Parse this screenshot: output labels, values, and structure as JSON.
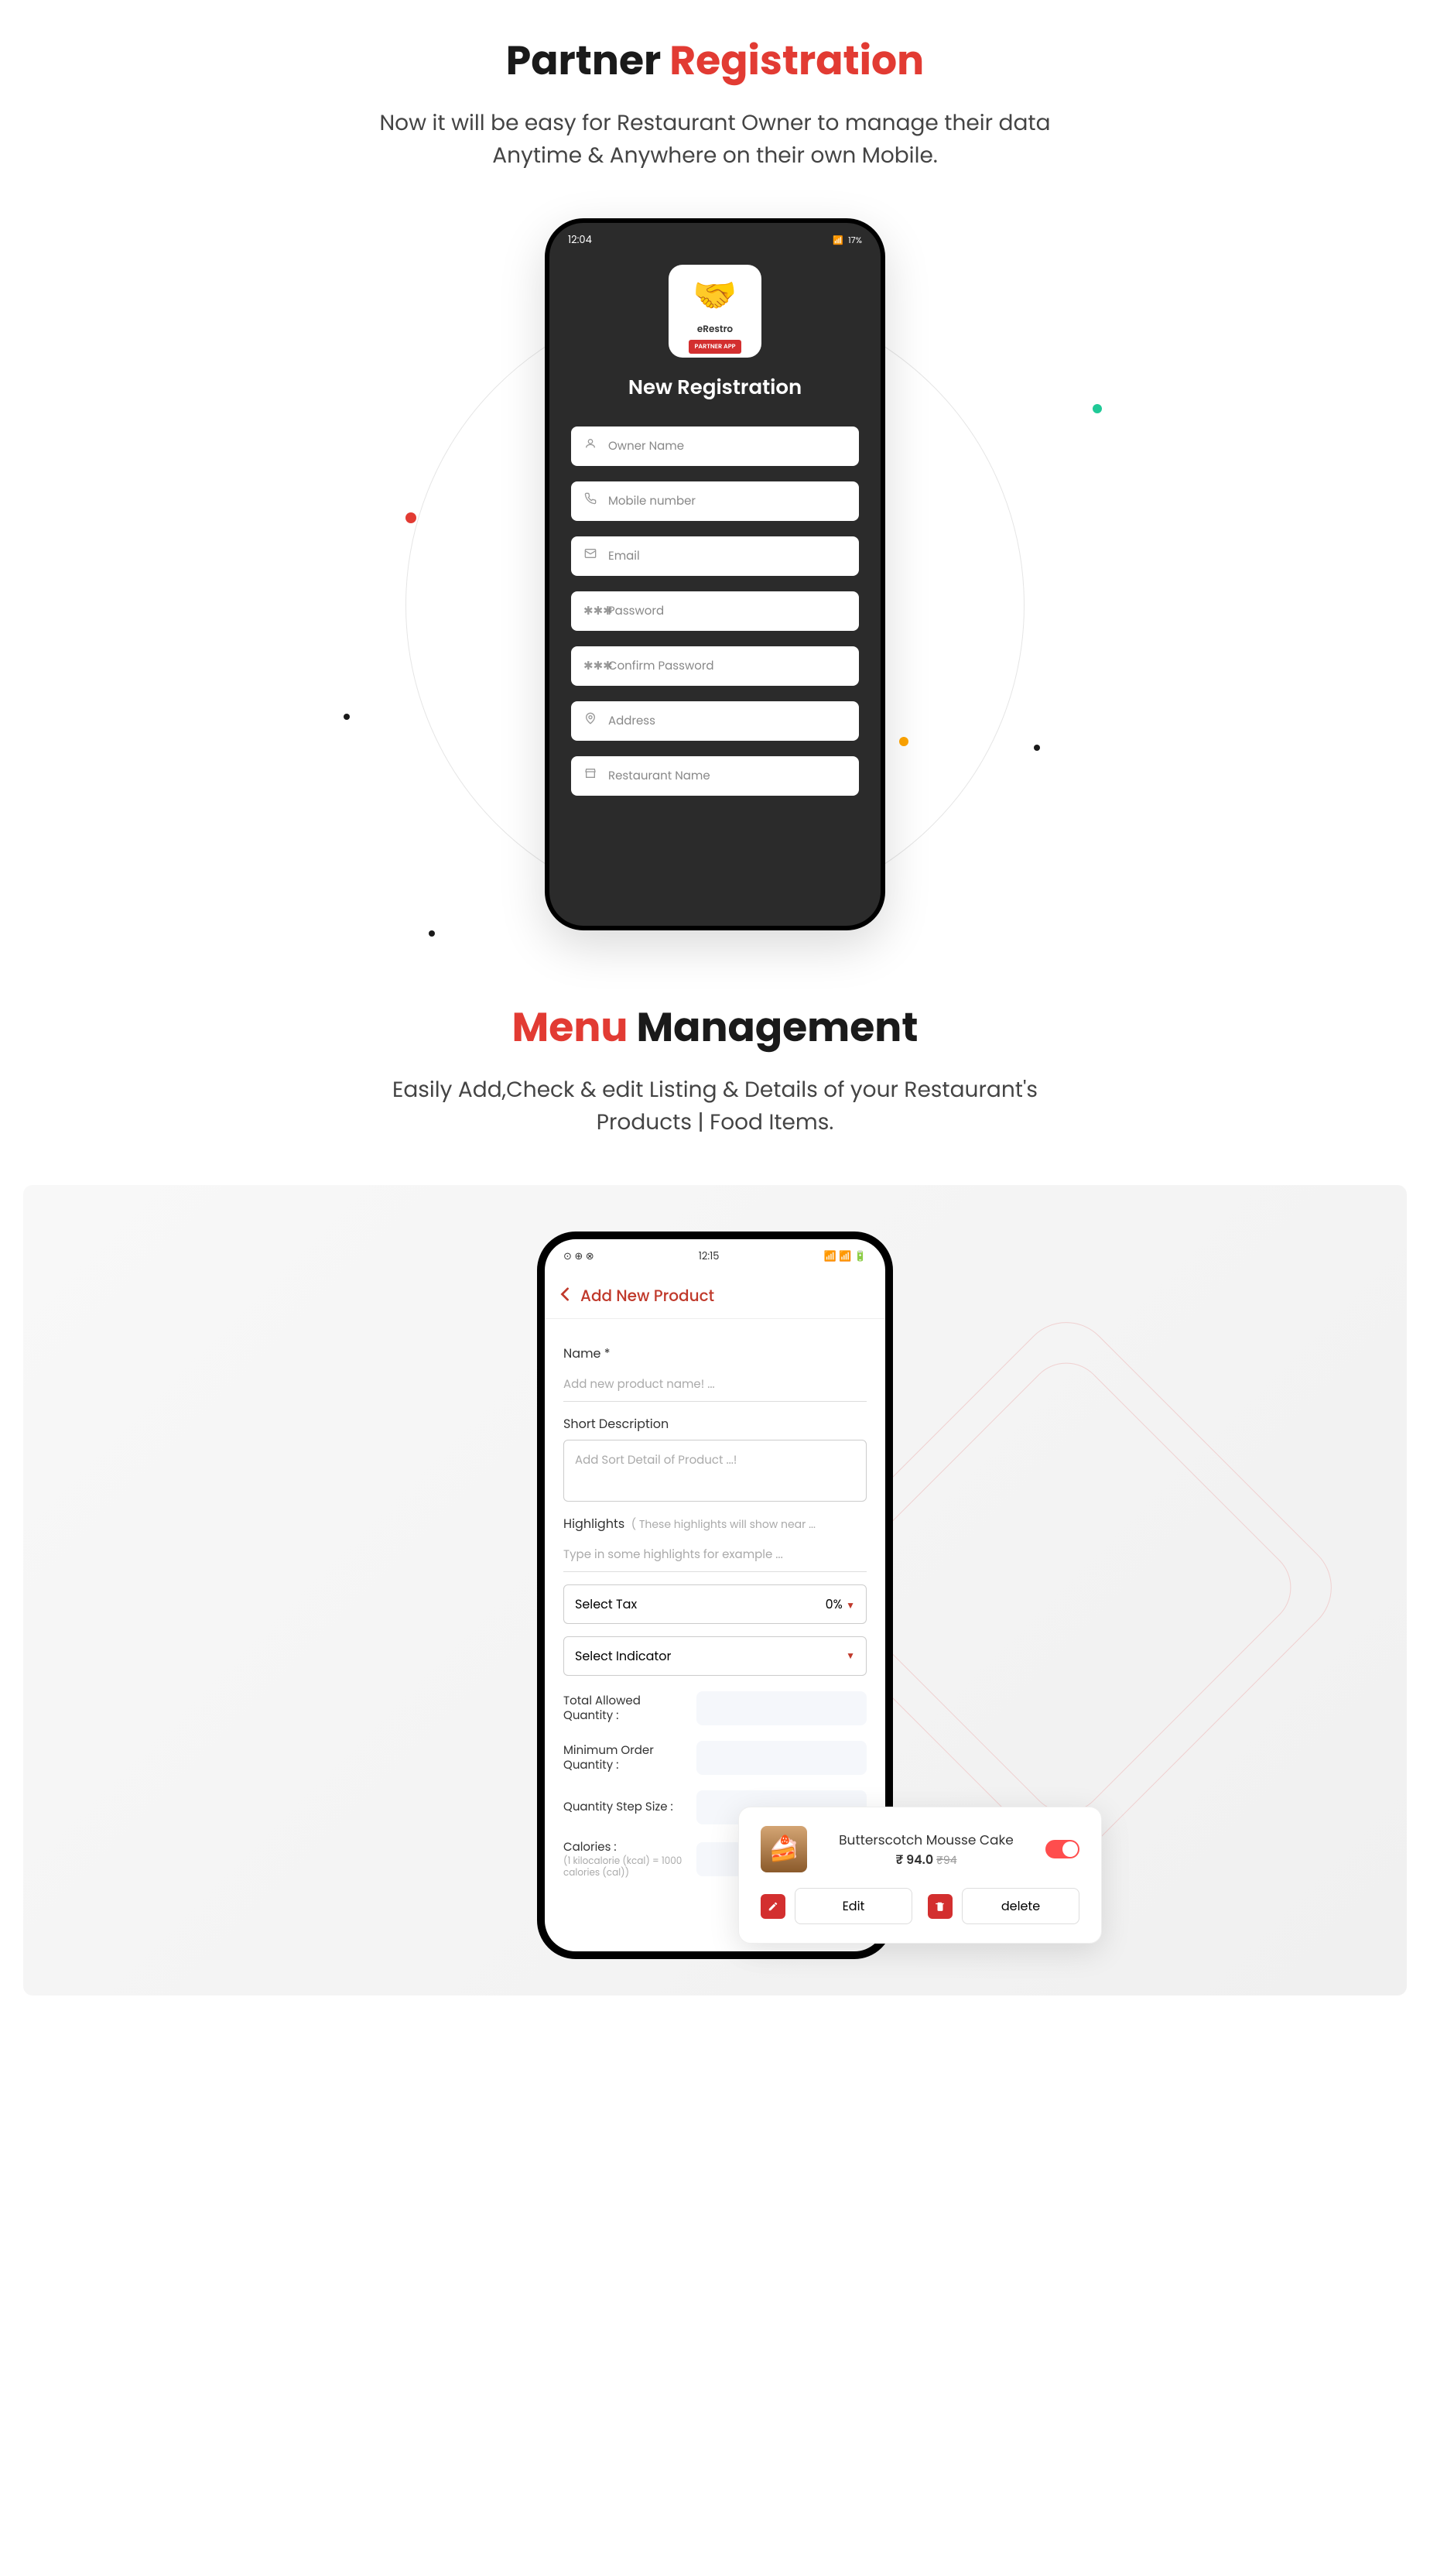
{
  "section1": {
    "title_pre": "Partner ",
    "title_red": "Registration",
    "subtitle": "Now it will be easy for Restaurant Owner to manage their data Anytime & Anywhere on their own Mobile."
  },
  "phone1": {
    "status_time": "12:04",
    "status_battery": "17%",
    "logo_text": "eRestro",
    "logo_badge": "PARTNER APP",
    "screen_title": "New Registration",
    "fields": [
      {
        "placeholder": "Owner Name",
        "icon": "user"
      },
      {
        "placeholder": "Mobile number",
        "icon": "phone"
      },
      {
        "placeholder": "Email",
        "icon": "mail"
      },
      {
        "placeholder": "Password",
        "icon": "lock"
      },
      {
        "placeholder": "Confirm Password",
        "icon": "lock"
      },
      {
        "placeholder": "Address",
        "icon": "pin"
      },
      {
        "placeholder": "Restaurant Name",
        "icon": "store"
      }
    ]
  },
  "section2": {
    "title_red": "Menu ",
    "title_post": "Management",
    "subtitle": "Easily Add,Check & edit Listing & Details of your Restaurant's Products | Food Items."
  },
  "phone2": {
    "status_time": "12:15",
    "screen_title": "Add New Product",
    "name_label": "Name *",
    "name_placeholder": "Add new product name! ...",
    "desc_label": "Short Description",
    "desc_placeholder": "Add Sort Detail of Product ...!",
    "highlights_label": "Highlights",
    "highlights_hint": "( These highlights will show near ...",
    "highlights_placeholder": "Type in some highlights for example ...",
    "tax_label": "Select Tax",
    "tax_value": "0%",
    "indicator_label": "Select Indicator",
    "qty1": "Total Allowed Quantity :",
    "qty2": "Minimum Order Quantity :",
    "qty3": "Quantity Step Size :",
    "calories_label": "Calories :",
    "calories_hint": "(1 kilocalorie (kcal) = 1000 calories (cal))"
  },
  "popup": {
    "name": "Butterscotch Mousse Cake",
    "price": "₹ 94.0",
    "old_price": "₹94",
    "edit_label": "Edit",
    "delete_label": "delete"
  }
}
